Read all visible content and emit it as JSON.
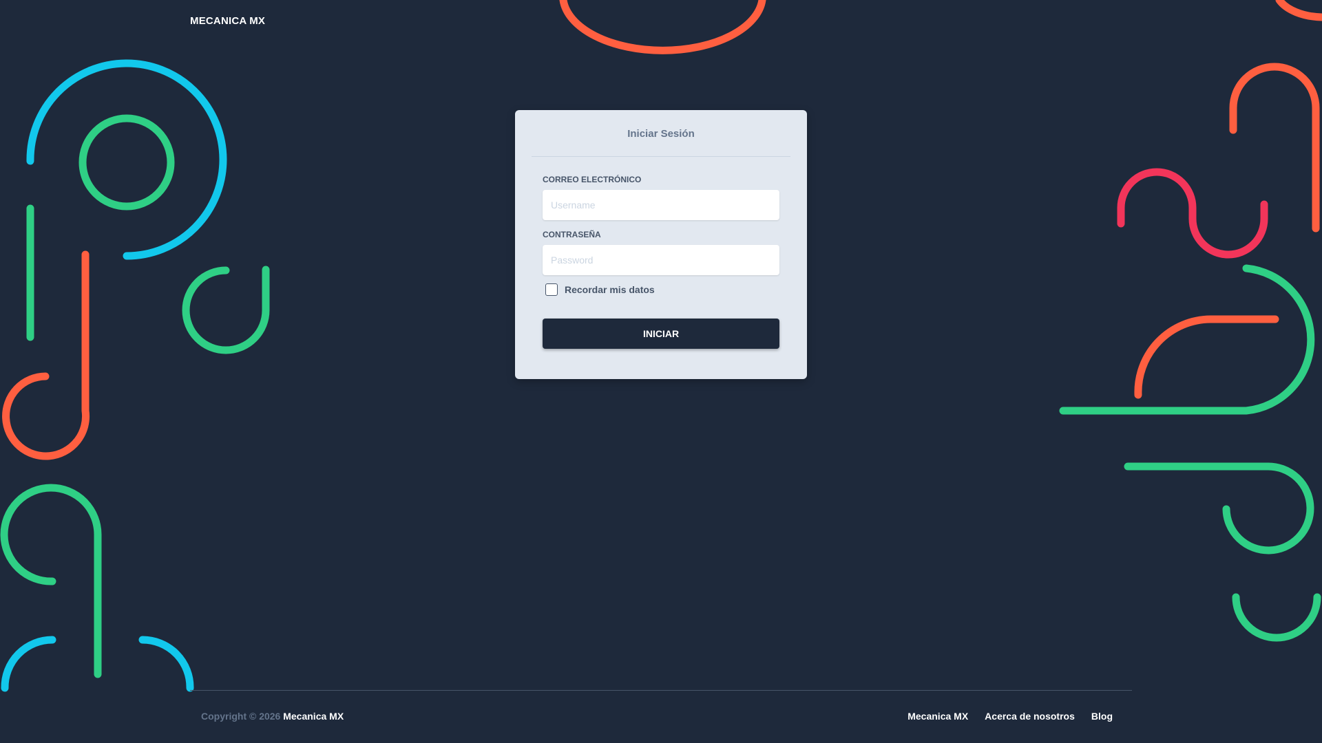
{
  "brand": {
    "name": "MECANICA MX"
  },
  "login": {
    "title": "Iniciar Sesión",
    "email_label": "CORREO ELECTRÓNICO",
    "email_placeholder": "Username",
    "email_value": "",
    "password_label": "CONTRASEÑA",
    "password_placeholder": "Password",
    "password_value": "",
    "remember_label": "Recordar mis datos",
    "remember_checked": false,
    "submit_label": "INICIAR"
  },
  "footer": {
    "copyright_prefix": "Copyright © 2026",
    "copyright_owner": "Mecanica MX",
    "links": [
      {
        "label": "Mecanica MX"
      },
      {
        "label": "Acerca de nosotros"
      },
      {
        "label": "Blog"
      }
    ]
  },
  "colors": {
    "background": "#1e293b",
    "card": "#e2e8f0",
    "accent_orange": "#ff5f40",
    "accent_green": "#2fcf85",
    "accent_blue": "#12c8ec",
    "accent_red": "#f2355a"
  }
}
